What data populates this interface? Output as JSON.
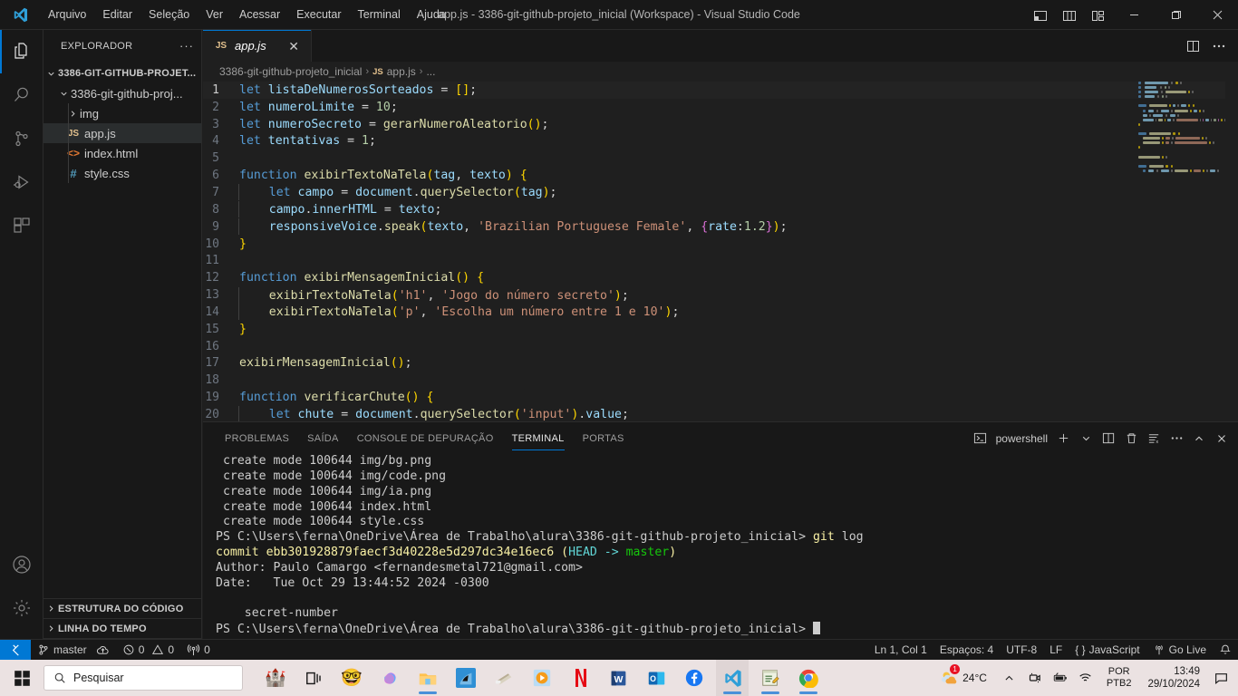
{
  "window": {
    "title": "app.js - 3386-git-github-projeto_inicial (Workspace) - Visual Studio Code",
    "menu": [
      "Arquivo",
      "Editar",
      "Seleção",
      "Ver",
      "Acessar",
      "Executar",
      "Terminal",
      "Ajuda"
    ],
    "layout_icons": [
      "toggle-primary-sidebar-icon",
      "toggle-panel-icon",
      "toggle-secondary-sidebar-icon",
      "customize-layout-icon"
    ],
    "controls": {
      "minimize": "—",
      "maximize": "❐",
      "close": "✕"
    }
  },
  "activitybar": {
    "items": [
      {
        "name": "explorer",
        "icon": "files-icon",
        "active": true
      },
      {
        "name": "search",
        "icon": "search-icon",
        "active": false
      },
      {
        "name": "source-control",
        "icon": "source-control-icon",
        "active": false
      },
      {
        "name": "run-debug",
        "icon": "run-and-debug-icon",
        "active": false
      },
      {
        "name": "extensions",
        "icon": "extensions-icon",
        "active": false
      }
    ],
    "bottom": [
      {
        "name": "accounts",
        "icon": "account-icon"
      },
      {
        "name": "settings",
        "icon": "gear-icon"
      }
    ]
  },
  "sidebar": {
    "title": "EXPLORADOR",
    "more_actions": "···",
    "tree": [
      {
        "label": "3386-GIT-GITHUB-PROJET...",
        "icon": "chevron-down-icon",
        "kind": "workspace",
        "indent": 0,
        "selected": false
      },
      {
        "label": "3386-git-github-proj...",
        "icon": "chevron-down-icon",
        "kind": "folder",
        "indent": 1,
        "selected": false
      },
      {
        "label": "img",
        "icon": "chevron-right-icon",
        "kind": "folder",
        "indent": 2,
        "selected": false
      },
      {
        "label": "app.js",
        "icon": "js-file-icon",
        "kind": "file",
        "indent": 2,
        "selected": true
      },
      {
        "label": "index.html",
        "icon": "html-file-icon",
        "kind": "file",
        "indent": 2,
        "selected": false
      },
      {
        "label": "style.css",
        "icon": "css-file-icon",
        "kind": "file",
        "indent": 2,
        "selected": false
      }
    ],
    "sections": [
      {
        "label": "ESTRUTURA DO CÓDIGO",
        "icon": "chevron-right-icon"
      },
      {
        "label": "LINHA DO TEMPO",
        "icon": "chevron-right-icon"
      }
    ]
  },
  "editor": {
    "tab": {
      "label": "app.js",
      "icon": "js-file-icon",
      "close": "✕",
      "preview": true
    },
    "tab_actions": [
      "split-editor-icon",
      "more-actions-icon"
    ],
    "breadcrumb": [
      "3386-git-github-projeto_inicial",
      "app.js",
      "..."
    ],
    "code": [
      {
        "n": 1,
        "current": true,
        "tokens": [
          {
            "t": "let",
            "c": "kw"
          },
          {
            "t": " ",
            "c": "txt"
          },
          {
            "t": "listaDeNumerosSorteados",
            "c": "var"
          },
          {
            "t": " ",
            "c": "txt"
          },
          {
            "t": "=",
            "c": "op"
          },
          {
            "t": " ",
            "c": "txt"
          },
          {
            "t": "[]",
            "c": "pl"
          },
          {
            "t": ";",
            "c": "txt"
          }
        ]
      },
      {
        "n": 2,
        "tokens": [
          {
            "t": "let",
            "c": "kw"
          },
          {
            "t": " ",
            "c": "txt"
          },
          {
            "t": "numeroLimite",
            "c": "var"
          },
          {
            "t": " ",
            "c": "txt"
          },
          {
            "t": "=",
            "c": "op"
          },
          {
            "t": " ",
            "c": "txt"
          },
          {
            "t": "10",
            "c": "num"
          },
          {
            "t": ";",
            "c": "txt"
          }
        ]
      },
      {
        "n": 3,
        "tokens": [
          {
            "t": "let",
            "c": "kw"
          },
          {
            "t": " ",
            "c": "txt"
          },
          {
            "t": "numeroSecreto",
            "c": "var"
          },
          {
            "t": " ",
            "c": "txt"
          },
          {
            "t": "=",
            "c": "op"
          },
          {
            "t": " ",
            "c": "txt"
          },
          {
            "t": "gerarNumeroAleatorio",
            "c": "fn"
          },
          {
            "t": "()",
            "c": "pl"
          },
          {
            "t": ";",
            "c": "txt"
          }
        ]
      },
      {
        "n": 4,
        "tokens": [
          {
            "t": "let",
            "c": "kw"
          },
          {
            "t": " ",
            "c": "txt"
          },
          {
            "t": "tentativas",
            "c": "var"
          },
          {
            "t": " ",
            "c": "txt"
          },
          {
            "t": "=",
            "c": "op"
          },
          {
            "t": " ",
            "c": "txt"
          },
          {
            "t": "1",
            "c": "num"
          },
          {
            "t": ";",
            "c": "txt"
          }
        ]
      },
      {
        "n": 5,
        "tokens": []
      },
      {
        "n": 6,
        "tokens": [
          {
            "t": "function",
            "c": "kw"
          },
          {
            "t": " ",
            "c": "txt"
          },
          {
            "t": "exibirTextoNaTela",
            "c": "fn"
          },
          {
            "t": "(",
            "c": "pl"
          },
          {
            "t": "tag",
            "c": "var"
          },
          {
            "t": ", ",
            "c": "txt"
          },
          {
            "t": "texto",
            "c": "var"
          },
          {
            "t": ")",
            "c": "pl"
          },
          {
            "t": " ",
            "c": "txt"
          },
          {
            "t": "{",
            "c": "pl"
          }
        ]
      },
      {
        "n": 7,
        "indent": 1,
        "tokens": [
          {
            "t": "    ",
            "c": "txt"
          },
          {
            "t": "let",
            "c": "kw"
          },
          {
            "t": " ",
            "c": "txt"
          },
          {
            "t": "campo",
            "c": "var"
          },
          {
            "t": " ",
            "c": "txt"
          },
          {
            "t": "=",
            "c": "op"
          },
          {
            "t": " ",
            "c": "txt"
          },
          {
            "t": "document",
            "c": "var"
          },
          {
            "t": ".",
            "c": "txt"
          },
          {
            "t": "querySelector",
            "c": "fn"
          },
          {
            "t": "(",
            "c": "pl"
          },
          {
            "t": "tag",
            "c": "var"
          },
          {
            "t": ")",
            "c": "pl"
          },
          {
            "t": ";",
            "c": "txt"
          }
        ]
      },
      {
        "n": 8,
        "indent": 1,
        "tokens": [
          {
            "t": "    ",
            "c": "txt"
          },
          {
            "t": "campo",
            "c": "var"
          },
          {
            "t": ".",
            "c": "txt"
          },
          {
            "t": "innerHTML",
            "c": "prop"
          },
          {
            "t": " ",
            "c": "txt"
          },
          {
            "t": "=",
            "c": "op"
          },
          {
            "t": " ",
            "c": "txt"
          },
          {
            "t": "texto",
            "c": "var"
          },
          {
            "t": ";",
            "c": "txt"
          }
        ]
      },
      {
        "n": 9,
        "indent": 1,
        "tokens": [
          {
            "t": "    ",
            "c": "txt"
          },
          {
            "t": "responsiveVoice",
            "c": "var"
          },
          {
            "t": ".",
            "c": "txt"
          },
          {
            "t": "speak",
            "c": "fn"
          },
          {
            "t": "(",
            "c": "pl"
          },
          {
            "t": "texto",
            "c": "var"
          },
          {
            "t": ", ",
            "c": "txt"
          },
          {
            "t": "'Brazilian Portuguese Female'",
            "c": "str"
          },
          {
            "t": ", ",
            "c": "txt"
          },
          {
            "t": "{",
            "c": "pl2"
          },
          {
            "t": "rate",
            "c": "var"
          },
          {
            "t": ":",
            "c": "txt"
          },
          {
            "t": "1.2",
            "c": "num"
          },
          {
            "t": "}",
            "c": "pl2"
          },
          {
            "t": ")",
            "c": "pl"
          },
          {
            "t": ";",
            "c": "txt"
          }
        ]
      },
      {
        "n": 10,
        "tokens": [
          {
            "t": "}",
            "c": "pl"
          }
        ]
      },
      {
        "n": 11,
        "tokens": []
      },
      {
        "n": 12,
        "tokens": [
          {
            "t": "function",
            "c": "kw"
          },
          {
            "t": " ",
            "c": "txt"
          },
          {
            "t": "exibirMensagemInicial",
            "c": "fn"
          },
          {
            "t": "()",
            "c": "pl"
          },
          {
            "t": " ",
            "c": "txt"
          },
          {
            "t": "{",
            "c": "pl"
          }
        ]
      },
      {
        "n": 13,
        "indent": 1,
        "tokens": [
          {
            "t": "    ",
            "c": "txt"
          },
          {
            "t": "exibirTextoNaTela",
            "c": "fn"
          },
          {
            "t": "(",
            "c": "pl"
          },
          {
            "t": "'h1'",
            "c": "str"
          },
          {
            "t": ", ",
            "c": "txt"
          },
          {
            "t": "'Jogo do número secreto'",
            "c": "str"
          },
          {
            "t": ")",
            "c": "pl"
          },
          {
            "t": ";",
            "c": "txt"
          }
        ]
      },
      {
        "n": 14,
        "indent": 1,
        "tokens": [
          {
            "t": "    ",
            "c": "txt"
          },
          {
            "t": "exibirTextoNaTela",
            "c": "fn"
          },
          {
            "t": "(",
            "c": "pl"
          },
          {
            "t": "'p'",
            "c": "str"
          },
          {
            "t": ", ",
            "c": "txt"
          },
          {
            "t": "'Escolha um número entre 1 e 10'",
            "c": "str"
          },
          {
            "t": ")",
            "c": "pl"
          },
          {
            "t": ";",
            "c": "txt"
          }
        ]
      },
      {
        "n": 15,
        "tokens": [
          {
            "t": "}",
            "c": "pl"
          }
        ]
      },
      {
        "n": 16,
        "tokens": []
      },
      {
        "n": 17,
        "tokens": [
          {
            "t": "exibirMensagemInicial",
            "c": "fn"
          },
          {
            "t": "()",
            "c": "pl"
          },
          {
            "t": ";",
            "c": "txt"
          }
        ]
      },
      {
        "n": 18,
        "tokens": []
      },
      {
        "n": 19,
        "tokens": [
          {
            "t": "function",
            "c": "kw"
          },
          {
            "t": " ",
            "c": "txt"
          },
          {
            "t": "verificarChute",
            "c": "fn"
          },
          {
            "t": "()",
            "c": "pl"
          },
          {
            "t": " ",
            "c": "txt"
          },
          {
            "t": "{",
            "c": "pl"
          }
        ]
      },
      {
        "n": 20,
        "indent": 1,
        "tokens": [
          {
            "t": "    ",
            "c": "txt"
          },
          {
            "t": "let",
            "c": "kw"
          },
          {
            "t": " ",
            "c": "txt"
          },
          {
            "t": "chute",
            "c": "var"
          },
          {
            "t": " ",
            "c": "txt"
          },
          {
            "t": "=",
            "c": "op"
          },
          {
            "t": " ",
            "c": "txt"
          },
          {
            "t": "document",
            "c": "var"
          },
          {
            "t": ".",
            "c": "txt"
          },
          {
            "t": "querySelector",
            "c": "fn"
          },
          {
            "t": "(",
            "c": "pl"
          },
          {
            "t": "'input'",
            "c": "str"
          },
          {
            "t": ")",
            "c": "pl"
          },
          {
            "t": ".",
            "c": "txt"
          },
          {
            "t": "value",
            "c": "prop"
          },
          {
            "t": ";",
            "c": "txt"
          }
        ]
      }
    ]
  },
  "panel": {
    "tabs": [
      "PROBLEMAS",
      "SAÍDA",
      "CONSOLE DE DEPURAÇÃO",
      "TERMINAL",
      "PORTAS"
    ],
    "active_tab": "TERMINAL",
    "terminal_name": "powershell",
    "actions": [
      "new-terminal-icon",
      "terminal-dropdown-icon",
      "split-terminal-icon",
      "kill-terminal-icon",
      "clear-terminal-icon",
      "more-actions-icon",
      "maximize-panel-icon",
      "close-panel-icon"
    ],
    "lines": [
      [
        {
          "t": " create mode 100644 img/bg.png",
          "c": "t-white"
        }
      ],
      [
        {
          "t": " create mode 100644 img/code.png",
          "c": "t-white"
        }
      ],
      [
        {
          "t": " create mode 100644 img/ia.png",
          "c": "t-white"
        }
      ],
      [
        {
          "t": " create mode 100644 index.html",
          "c": "t-white"
        }
      ],
      [
        {
          "t": " create mode 100644 style.css",
          "c": "t-white"
        }
      ],
      [
        {
          "t": "PS C:\\Users\\ferna\\OneDrive\\Área de Trabalho\\alura\\3386-git-github-projeto_inicial> ",
          "c": "t-white"
        },
        {
          "t": "git",
          "c": "t-yellow"
        },
        {
          "t": " log",
          "c": "t-white"
        }
      ],
      [
        {
          "t": "commit ebb301928879faecf3d40228e5d297dc34e16ec6 ",
          "c": "t-yellow"
        },
        {
          "t": "(",
          "c": "t-yellow"
        },
        {
          "t": "HEAD -> ",
          "c": "t-cyan"
        },
        {
          "t": "master",
          "c": "t-green"
        },
        {
          "t": ")",
          "c": "t-yellow"
        }
      ],
      [
        {
          "t": "Author: Paulo Camargo <fernandesmetal721@gmail.com>",
          "c": "t-white"
        }
      ],
      [
        {
          "t": "Date:   Tue Oct 29 13:44:52 2024 -0300",
          "c": "t-white"
        }
      ],
      [
        {
          "t": "",
          "c": "t-white"
        }
      ],
      [
        {
          "t": "    secret-number",
          "c": "t-white"
        }
      ],
      [
        {
          "t": "PS C:\\Users\\ferna\\OneDrive\\Área de Trabalho\\alura\\3386-git-github-projeto_inicial> ",
          "c": "t-white"
        }
      ]
    ]
  },
  "statusbar": {
    "remote_icon": "remote-window-icon",
    "left": [
      {
        "name": "branch",
        "icon": "source-control-icon",
        "label": "master"
      },
      {
        "name": "sync",
        "icon": "cloud-upload-icon",
        "label": ""
      },
      {
        "name": "problems",
        "icon": "error-warning-icon",
        "label": "0 0"
      },
      {
        "name": "ports",
        "icon": "radio-tower-icon",
        "label": "0"
      }
    ],
    "right": [
      {
        "name": "cursor-position",
        "label": "Ln 1, Col 1"
      },
      {
        "name": "indentation",
        "label": "Espaços: 4"
      },
      {
        "name": "encoding",
        "label": "UTF-8"
      },
      {
        "name": "eol",
        "label": "LF"
      },
      {
        "name": "language-mode",
        "label": "JavaScript",
        "icon": "braces-icon"
      },
      {
        "name": "go-live",
        "label": "Go Live",
        "icon": "broadcast-icon"
      },
      {
        "name": "notifications",
        "label": "",
        "icon": "bell-icon"
      }
    ]
  },
  "taskbar": {
    "start_icon": "windows-start-icon",
    "search_placeholder": "Pesquisar",
    "apps": [
      {
        "name": "task-view",
        "icon": "task-view-icon",
        "glyph": "",
        "running": false
      },
      {
        "name": "widgets-castle",
        "icon": "castle-widget-icon",
        "glyph": "🏰",
        "running": false
      },
      {
        "name": "emoji-app",
        "icon": "emoji-app-icon",
        "glyph": "🤓",
        "running": false
      },
      {
        "name": "copilot",
        "icon": "copilot-icon",
        "glyph": "",
        "running": false
      },
      {
        "name": "file-explorer",
        "icon": "file-explorer-icon",
        "glyph": "📁",
        "running": true
      },
      {
        "name": "reader-app",
        "icon": "reader-app-icon",
        "glyph": "",
        "running": false
      },
      {
        "name": "tool-app",
        "icon": "tool-app-icon",
        "glyph": "",
        "running": false
      },
      {
        "name": "media-player",
        "icon": "media-player-icon",
        "glyph": "",
        "running": false
      },
      {
        "name": "netflix",
        "icon": "netflix-icon",
        "glyph": "N",
        "running": false
      },
      {
        "name": "word",
        "icon": "word-icon",
        "glyph": "W",
        "running": false
      },
      {
        "name": "outlook",
        "icon": "outlook-icon",
        "glyph": "O",
        "running": false
      },
      {
        "name": "facebook",
        "icon": "facebook-icon",
        "glyph": "f",
        "running": false
      },
      {
        "name": "vscode",
        "icon": "vscode-icon",
        "glyph": "",
        "running": true,
        "active": true
      },
      {
        "name": "notepad-plus",
        "icon": "notepad-icon",
        "glyph": "",
        "running": true
      },
      {
        "name": "chrome",
        "icon": "chrome-icon",
        "glyph": "",
        "running": true
      }
    ],
    "tray": {
      "weather_icon": "weather-partly-cloudy-icon",
      "weather_badge": "1",
      "temperature": "24°C",
      "chevron": "show-hidden-icons-icon",
      "icons": [
        "camera-icon",
        "battery-icon",
        "wifi-icon"
      ],
      "language": {
        "line1": "POR",
        "line2": "PTB2"
      },
      "clock": {
        "time": "13:49",
        "date": "29/10/2024"
      },
      "notification_icon": "notification-center-icon"
    }
  },
  "colors": {
    "accent": "#0078d4",
    "titlebar_bg": "#181818",
    "editor_bg": "#1f1f1f",
    "taskbar_bg": "#ebe2e2"
  }
}
